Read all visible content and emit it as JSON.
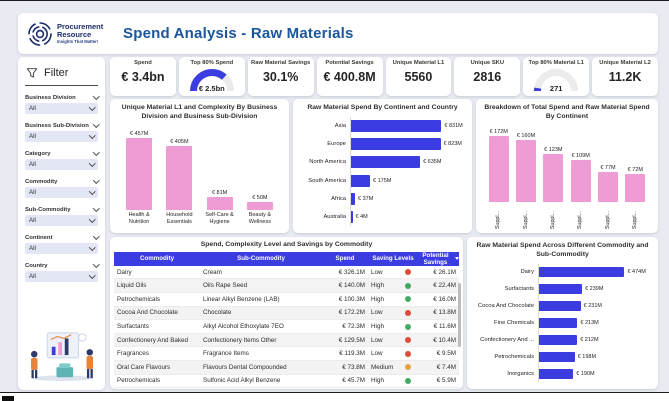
{
  "header": {
    "logo_line1": "Procurement",
    "logo_line2": "Resource",
    "logo_tagline": "Insights That Matter!",
    "title": "Spend Analysis - Raw Materials"
  },
  "kpis": [
    {
      "label": "Spend",
      "value": "€ 3.4bn"
    },
    {
      "label": "Top 80% Spend",
      "value": "€ 2.5bn",
      "fraction": 0.735
    },
    {
      "label": "Raw Material Savings",
      "value": "30.1%"
    },
    {
      "label": "Potential Savings",
      "value": "€ 400.8M"
    },
    {
      "label": "Unique Material L1",
      "value": "5560"
    },
    {
      "label": "Unique SKU",
      "value": "2816"
    },
    {
      "label": "Top 80% Material L1",
      "value": "271",
      "fraction": 0.05
    },
    {
      "label": "Unique Material L2",
      "value": "11.2K"
    }
  ],
  "sidebar": {
    "title": "Filter",
    "filters": [
      {
        "label": "Business Division",
        "value": "All"
      },
      {
        "label": "Business Sub-Division",
        "value": "All"
      },
      {
        "label": "Category",
        "value": "All"
      },
      {
        "label": "Commodity",
        "value": "All"
      },
      {
        "label": "Sub-Commodity",
        "value": "All"
      },
      {
        "label": "Continent",
        "value": "All"
      },
      {
        "label": "Country",
        "value": "All"
      }
    ]
  },
  "chart_data": [
    {
      "id": "division-chart",
      "type": "bar",
      "title": "Unique Material L1 and Complexity By Business Division and Business Sub-Division",
      "categories": [
        "Health & Nutrition",
        "Household Essentials",
        "Self-Care & Hygiene",
        "Beauty & Wellness"
      ],
      "values": [
        457,
        405,
        81,
        50
      ],
      "labels": [
        "€ 457M",
        "€ 405M",
        "€ 81M",
        "€ 50M"
      ],
      "unit": "EUR millions",
      "color": "#ef9cd5",
      "grid": false
    },
    {
      "id": "continent-chart",
      "type": "bar",
      "orientation": "horizontal",
      "title": "Raw Material Spend By Continent and Country",
      "categories": [
        "Asia",
        "Europe",
        "North America",
        "South America",
        "Africa",
        "Australia"
      ],
      "values": [
        831,
        823,
        635,
        175,
        37,
        4
      ],
      "labels": [
        "€ 831M",
        "€ 823M",
        "€ 635M",
        "€ 175M",
        "€ 37M",
        "€ 4M"
      ],
      "unit": "EUR millions",
      "color": "#3b3de0",
      "grid": false
    },
    {
      "id": "supplier-chart",
      "type": "bar",
      "title": "Breakdown of Total Spend and Raw Material Spend By Continent",
      "categories": [
        "Suppl...",
        "Suppl...",
        "Suppl...",
        "Suppl...",
        "Suppl...",
        "Suppl..."
      ],
      "values": [
        172,
        160,
        123,
        109,
        77,
        72
      ],
      "labels": [
        "€ 172M",
        "€ 160M",
        "€ 123M",
        "€ 109M",
        "€ 77M",
        "€ 72M"
      ],
      "unit": "EUR millions",
      "color": "#ef9cd5",
      "rotated_category_labels": true,
      "grid": false
    },
    {
      "id": "commodity-chart",
      "type": "bar",
      "orientation": "horizontal",
      "title": "Raw Material Spend Across Different Commodity and Sub-Commodity",
      "categories": [
        "Dairy",
        "Surfactants",
        "Cocoa And Chocolate",
        "Fine Chemicals",
        "Confectionery And ...",
        "Petrochemicals",
        "Inorganics"
      ],
      "values": [
        474,
        239,
        231,
        213,
        212,
        198,
        190
      ],
      "labels": [
        "€ 474M",
        "€ 239M",
        "€ 231M",
        "€ 213M",
        "€ 212M",
        "€ 198M",
        "€ 190M"
      ],
      "unit": "EUR millions",
      "color": "#3b3de0",
      "grid": false
    }
  ],
  "table": {
    "title": "Spend, Complexity Level and Savings by Commodity",
    "columns": [
      "Commodity",
      "Sub-Commodity",
      "Spend",
      "Saving Levels",
      "Potential Savings"
    ],
    "sorted_by": "Potential Savings",
    "level_colors": {
      "Low": "#dd4b39",
      "Medium": "#e2a03f",
      "High": "#45a964"
    },
    "rows": [
      {
        "commodity": "Dairy",
        "sub_commodity": "Cream",
        "spend": "€ 326.1M",
        "saving_level": "Low",
        "potential_savings": "€ 26.1M"
      },
      {
        "commodity": "Liquid Oils",
        "sub_commodity": "Oils Rape Seed",
        "spend": "€ 140.0M",
        "saving_level": "High",
        "potential_savings": "€ 22.4M"
      },
      {
        "commodity": "Petrochemicals",
        "sub_commodity": "Linear Alkyl Benzene (LAB)",
        "spend": "€ 100.3M",
        "saving_level": "High",
        "potential_savings": "€ 16.0M"
      },
      {
        "commodity": "Cocoa And Chocolate",
        "sub_commodity": "Chocolate",
        "spend": "€ 172.2M",
        "saving_level": "Low",
        "potential_savings": "€ 13.8M"
      },
      {
        "commodity": "Surfactants",
        "sub_commodity": "Alkyl Alcohol Ethoxylate 7EO",
        "spend": "€ 72.3M",
        "saving_level": "High",
        "potential_savings": "€ 11.6M"
      },
      {
        "commodity": "Confectionery And Baked",
        "sub_commodity": "Confectionery Items Other",
        "spend": "€ 129.5M",
        "saving_level": "Low",
        "potential_savings": "€ 10.4M"
      },
      {
        "commodity": "Fragrances",
        "sub_commodity": "Fragrance Items",
        "spend": "€ 119.3M",
        "saving_level": "Low",
        "potential_savings": "€ 9.5M"
      },
      {
        "commodity": "Oral Care Flavours",
        "sub_commodity": "Flavours Dental Compounded",
        "spend": "€ 73.8M",
        "saving_level": "Medium",
        "potential_savings": "€ 7.4M"
      },
      {
        "commodity": "Petrochemicals",
        "sub_commodity": "Sulfonic Acid Alkyl Benzene",
        "spend": "€ 45.7M",
        "saving_level": "High",
        "potential_savings": "€ 5.9M"
      }
    ]
  }
}
